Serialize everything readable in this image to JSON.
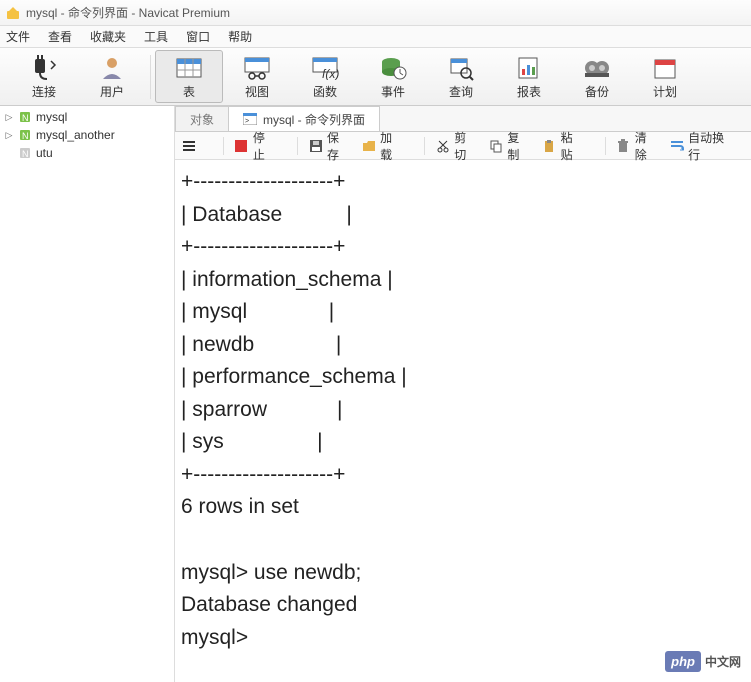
{
  "title": "mysql - 命令列界面 - Navicat Premium",
  "menus": [
    "文件",
    "查看",
    "收藏夹",
    "工具",
    "窗口",
    "帮助"
  ],
  "toolbar": [
    {
      "label": "连接"
    },
    {
      "label": "用户"
    },
    {
      "label": "表",
      "selected": true
    },
    {
      "label": "视图"
    },
    {
      "label": "函数"
    },
    {
      "label": "事件"
    },
    {
      "label": "查询"
    },
    {
      "label": "报表"
    },
    {
      "label": "备份"
    },
    {
      "label": "计划"
    }
  ],
  "sidebar": [
    {
      "label": "mysql",
      "expandable": true,
      "active": true
    },
    {
      "label": "mysql_another",
      "expandable": true,
      "active": true
    },
    {
      "label": "utu",
      "expandable": false,
      "active": false
    }
  ],
  "tabs": [
    {
      "label": "对象",
      "active": false
    },
    {
      "label": "mysql - 命令列界面",
      "active": true
    }
  ],
  "subtool": {
    "stop": "停止",
    "save": "保存",
    "load": "加载",
    "cut": "剪切",
    "copy": "复制",
    "paste": "粘贴",
    "clear": "清除",
    "wrap": "自动换行"
  },
  "console_text": "+--------------------+\n| Database           |\n+--------------------+\n| information_schema |\n| mysql              |\n| newdb              |\n| performance_schema |\n| sparrow            |\n| sys                |\n+--------------------+\n6 rows in set\n\nmysql> use newdb;\nDatabase changed\nmysql>",
  "watermark": "中文网"
}
